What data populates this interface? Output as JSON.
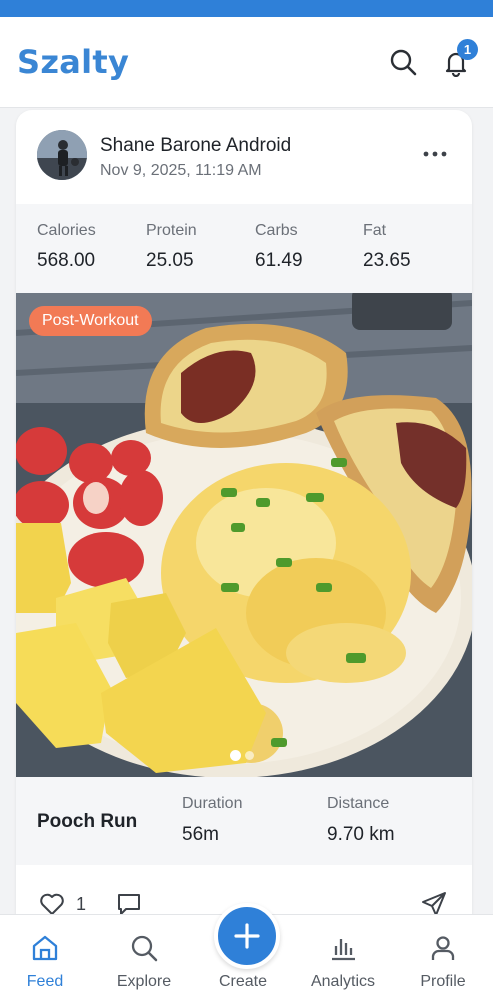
{
  "app": {
    "title": "Szalty",
    "notification_count": "1"
  },
  "post": {
    "user_name": "Shane Barone Android",
    "timestamp": "Nov 9, 2025, 11:19 AM",
    "macros": [
      {
        "label": "Calories",
        "value": "568.00"
      },
      {
        "label": "Protein",
        "value": "25.05"
      },
      {
        "label": "Carbs",
        "value": "61.49"
      },
      {
        "label": "Fat",
        "value": "23.65"
      }
    ],
    "tag": "Post-Workout",
    "photo": {
      "slide_count": 2,
      "active_slide": 1
    },
    "workout": {
      "name": "Pooch Run",
      "stats": [
        {
          "label": "Duration",
          "value": "56m"
        },
        {
          "label": "Distance",
          "value": "9.70 km"
        }
      ]
    },
    "like_count": "1"
  },
  "nav": {
    "items": [
      {
        "label": "Feed",
        "icon": "home-icon",
        "active": true
      },
      {
        "label": "Explore",
        "icon": "search-icon",
        "active": false
      },
      {
        "label": "Create",
        "icon": "plus-icon",
        "active": false
      },
      {
        "label": "Analytics",
        "icon": "bar-chart-icon",
        "active": false
      },
      {
        "label": "Profile",
        "icon": "person-icon",
        "active": false
      }
    ]
  },
  "colors": {
    "accent": "#2f80d8",
    "brand": "#3a86d4",
    "tag": "#f27a55"
  }
}
